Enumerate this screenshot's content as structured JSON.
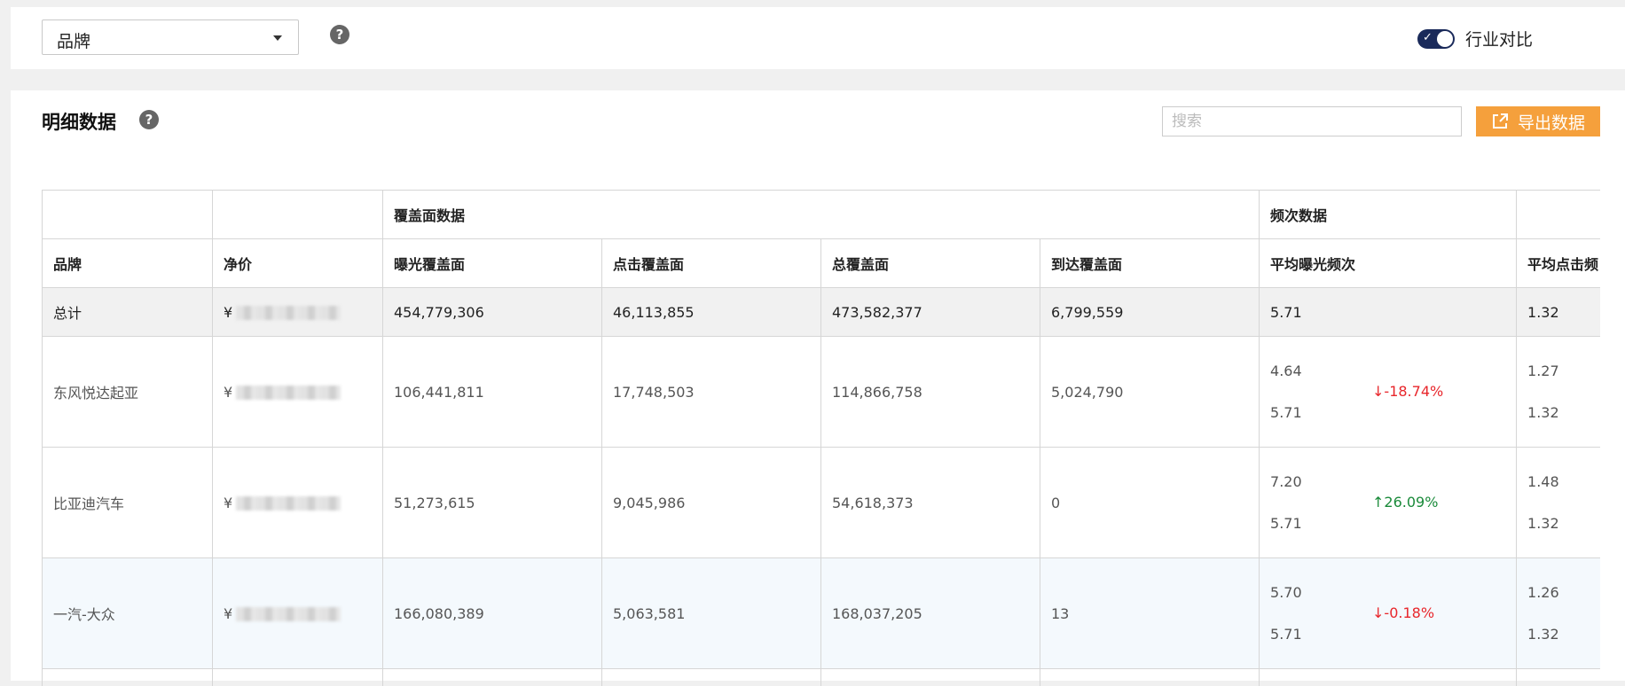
{
  "filter": {
    "selected": "品牌",
    "help": "?"
  },
  "toggle": {
    "label": "行业对比",
    "checked": true,
    "check_glyph": "✓"
  },
  "panel": {
    "title": "明细数据",
    "search_placeholder": "搜索",
    "export_label": "导出数据",
    "group_headers": [
      "",
      "",
      "覆盖面数据",
      "频次数据",
      ""
    ],
    "columns": [
      "品牌",
      "净价",
      "曝光覆盖面",
      "点击覆盖面",
      "总覆盖面",
      "到达覆盖面",
      "平均曝光频次",
      "平均点击频"
    ],
    "total": {
      "brand": "总计",
      "currency": "¥",
      "exposure": "454,779,306",
      "click": "46,113,855",
      "total": "473,582,377",
      "reach": "6,799,559",
      "avg_exposure": "5.71",
      "avg_click": "1.32"
    },
    "rows": [
      {
        "brand": "东风悦达起亚",
        "currency": "¥",
        "exposure": "106,441,811",
        "click": "17,748,503",
        "total": "114,866,758",
        "reach": "5,024,790",
        "avg_exposure": "4.64",
        "avg_exposure_industry": "5.71",
        "change": "↓-18.74%",
        "avg_click": "1.27",
        "avg_click_industry": "1.32"
      },
      {
        "brand": "比亚迪汽车",
        "currency": "¥",
        "exposure": "51,273,615",
        "click": "9,045,986",
        "total": "54,618,373",
        "reach": "0",
        "avg_exposure": "7.20",
        "avg_exposure_industry": "5.71",
        "change": "↑26.09%",
        "avg_click": "1.48",
        "avg_click_industry": "1.32"
      },
      {
        "brand": "一汽-大众",
        "currency": "¥",
        "exposure": "166,080,389",
        "click": "5,063,581",
        "total": "168,037,205",
        "reach": "13",
        "avg_exposure": "5.70",
        "avg_exposure_industry": "5.71",
        "change": "↓-0.18%",
        "avg_click": "1.26",
        "avg_click_industry": "1.32"
      }
    ]
  },
  "colors": {
    "accent": "#f5a03c",
    "toggle": "#1a2a5a",
    "down": "#e8262b",
    "up": "#1a8a3a"
  },
  "icons": {
    "help": "question-circle-icon",
    "export": "external-link-icon",
    "dropdown": "caret-down-icon"
  }
}
